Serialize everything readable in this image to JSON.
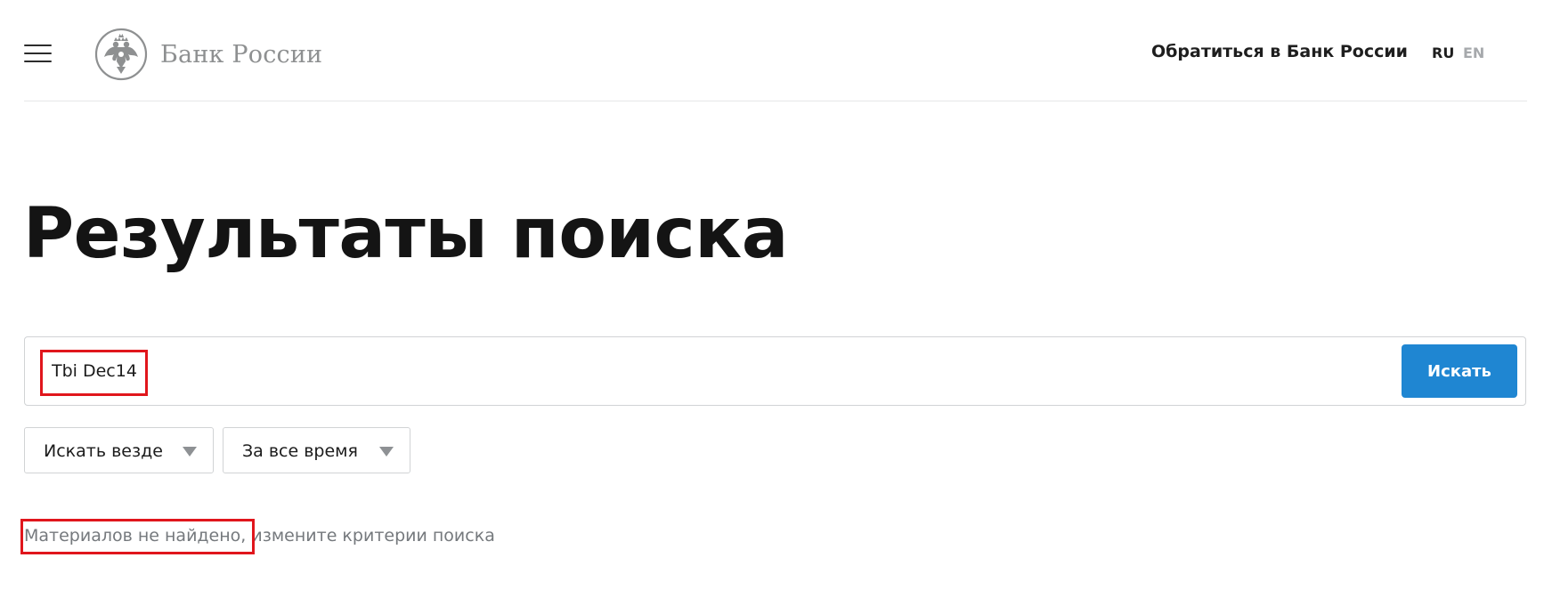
{
  "header": {
    "logo_text": "Банк России",
    "contact_link": "Обратиться в Банк России",
    "languages": [
      {
        "code": "RU",
        "active": true
      },
      {
        "code": "EN",
        "active": false
      }
    ]
  },
  "page": {
    "title": "Результаты поиска"
  },
  "search": {
    "query": "Tbi Dec14",
    "button_label": "Искать"
  },
  "filters": {
    "scope": {
      "selected": "Искать везде"
    },
    "period": {
      "selected": "За все время"
    }
  },
  "results": {
    "empty_message": "Материалов не найдено,",
    "hint": "измените критерии поиска"
  },
  "colors": {
    "accent": "#1f86d2",
    "highlight": "#e0161c",
    "muted_text": "#75797d",
    "logo_gray": "#8e9091"
  }
}
